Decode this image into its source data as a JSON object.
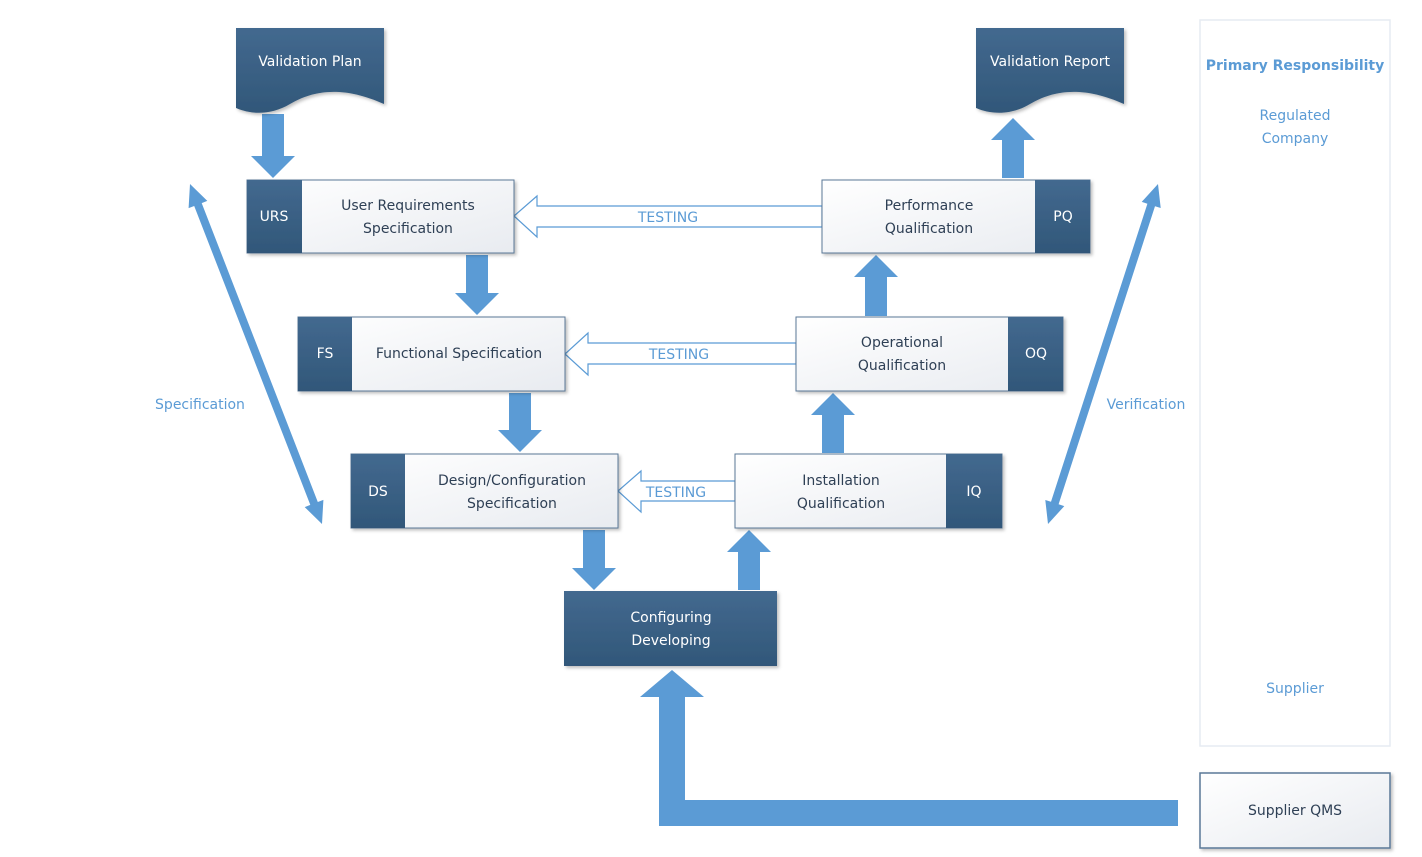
{
  "documents": {
    "validation_plan": "Validation Plan",
    "validation_report": "Validation Report"
  },
  "spec_boxes": [
    {
      "code": "URS",
      "line1": "User Requirements",
      "line2": "Specification"
    },
    {
      "code": "FS",
      "line1": "Functional Specification",
      "line2": ""
    },
    {
      "code": "DS",
      "line1": "Design/Configuration",
      "line2": "Specification"
    }
  ],
  "qual_boxes": [
    {
      "code": "PQ",
      "line1": "Performance",
      "line2": "Qualification"
    },
    {
      "code": "OQ",
      "line1": "Operational",
      "line2": "Qualification"
    },
    {
      "code": "IQ",
      "line1": "Installation",
      "line2": "Qualification"
    }
  ],
  "testing_label": "TESTING",
  "configuring": {
    "line1": "Configuring",
    "line2": "Developing"
  },
  "side_labels": {
    "specification": "Specification",
    "verification": "Verification"
  },
  "responsibility": {
    "title": "Primary Responsibility",
    "top_line1": "Regulated",
    "top_line2": "Company",
    "bottom": "Supplier"
  },
  "supplier_qms": "Supplier QMS",
  "colors": {
    "dark_blue": "#3a6188",
    "arrow_blue": "#5b9bd5",
    "text_blue": "#5b9bd5"
  }
}
